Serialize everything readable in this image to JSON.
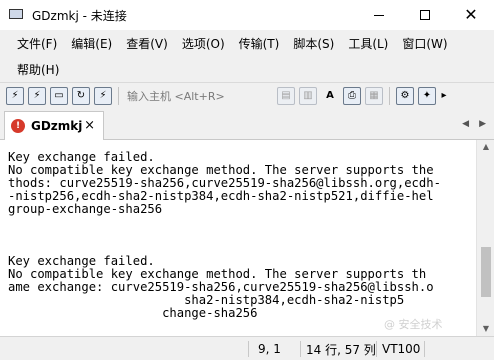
{
  "window": {
    "title": "GDzmkj - 未连接",
    "controls": [
      "minimize-icon",
      "maximize-icon",
      "close-icon"
    ]
  },
  "menu": {
    "row1": [
      "文件(F)",
      "编辑(E)",
      "查看(V)",
      "选项(O)",
      "传输(T)",
      "脚本(S)",
      "工具(L)",
      "窗口(W)"
    ],
    "row2": [
      "帮助(H)"
    ]
  },
  "toolbar": {
    "host_placeholder": "输入主机 <Alt+R>",
    "left_icons": [
      "connect-icon",
      "quick-connect-icon",
      "connect-tab-icon",
      "reconnect-icon",
      "disconnect-icon"
    ],
    "right_icons": [
      "copy-icon",
      "paste-icon",
      "find-icon",
      "print-icon",
      "print-setup-icon",
      "settings-icon",
      "global-options-icon",
      "toolbar-more-icon"
    ]
  },
  "tabs": {
    "active_label": "GDzmkj",
    "tab_close": "×",
    "nav_prev": "◀",
    "nav_next": "▶"
  },
  "terminal": {
    "lines": [
      "",
      "Key exchange failed.",
      "No compatible key exchange method. The server supports the",
      "thods: curve25519-sha256,curve25519-sha256@libssh.org,ecdh-",
      "-nistp256,ecdh-sha2-nistp384,ecdh-sha2-nistp521,diffie-hel",
      "group-exchange-sha256",
      "",
      "",
      "",
      "Key exchange failed.",
      "No compatible key exchange method. The server supports th",
      "ame exchange: curve25519-sha256,curve25519-sha256@libssh.o",
      "                        sha2-nistp384,ecdh-sha2-nistp5",
      "                     change-sha256"
    ]
  },
  "status": {
    "position": "9,  1",
    "rows_cols": "14 行, 57 列",
    "terminal_type": "VT100"
  },
  "watermark": "@ 安全技术"
}
